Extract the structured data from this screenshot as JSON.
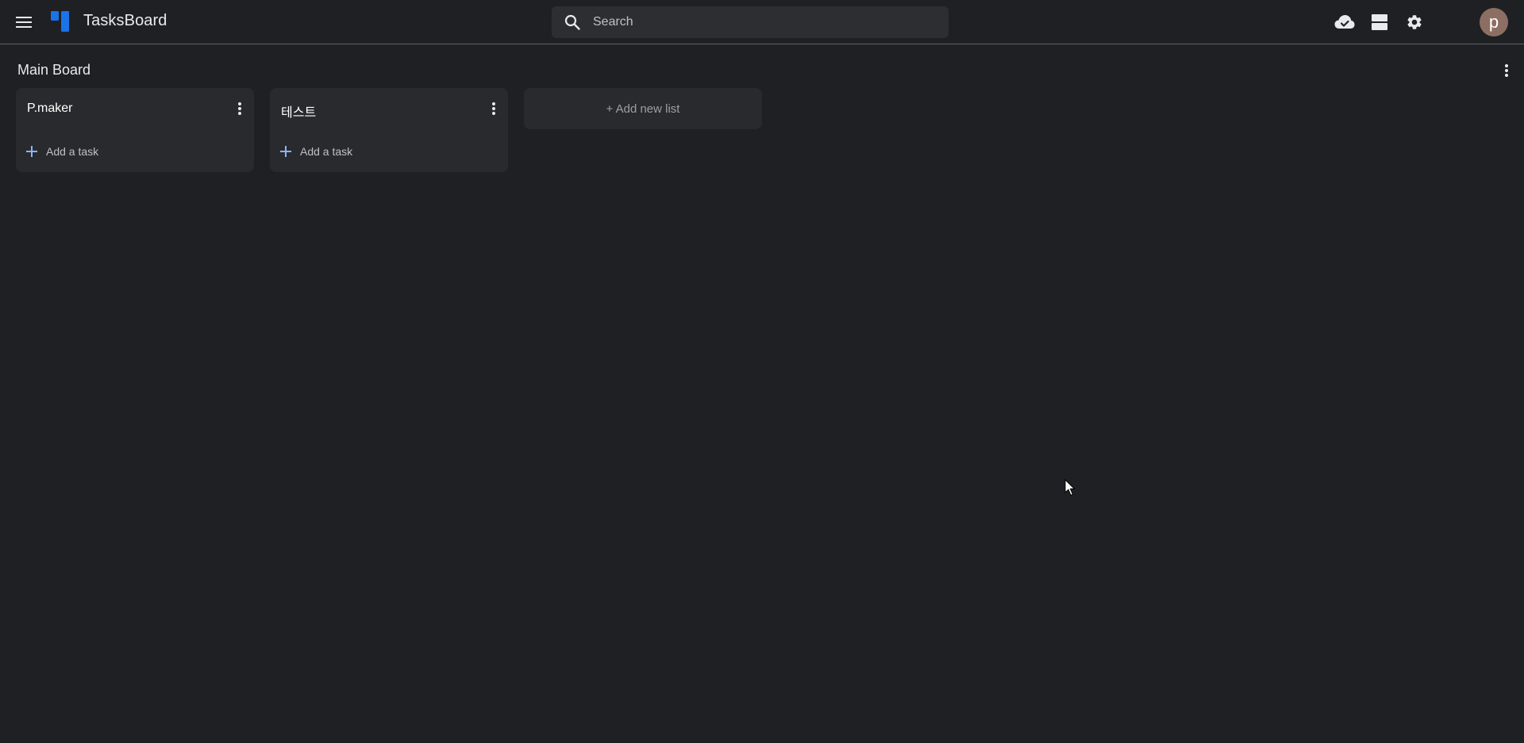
{
  "app": {
    "title": "TasksBoard"
  },
  "search": {
    "placeholder": "Search",
    "value": ""
  },
  "user": {
    "avatar_letter": "p"
  },
  "board": {
    "title": "Main Board",
    "lists": [
      {
        "title": "P.maker",
        "add_task_label": "Add a task"
      },
      {
        "title": "테스트",
        "add_task_label": "Add a task"
      }
    ],
    "add_list_label": "+ Add new list"
  },
  "icons": {
    "menu": "menu-icon",
    "logo": "tasksboard-logo",
    "search": "search-icon",
    "sync": "cloud-done-icon",
    "layout": "view-agenda-icon",
    "settings": "gear-icon",
    "more": "more-vert-icon",
    "add": "plus-icon"
  },
  "colors": {
    "background": "#1f2023",
    "list_background": "#292a2d",
    "accent": "#1a73e8",
    "add_icon": "#8ab4f8",
    "avatar": "#8d6e63"
  }
}
